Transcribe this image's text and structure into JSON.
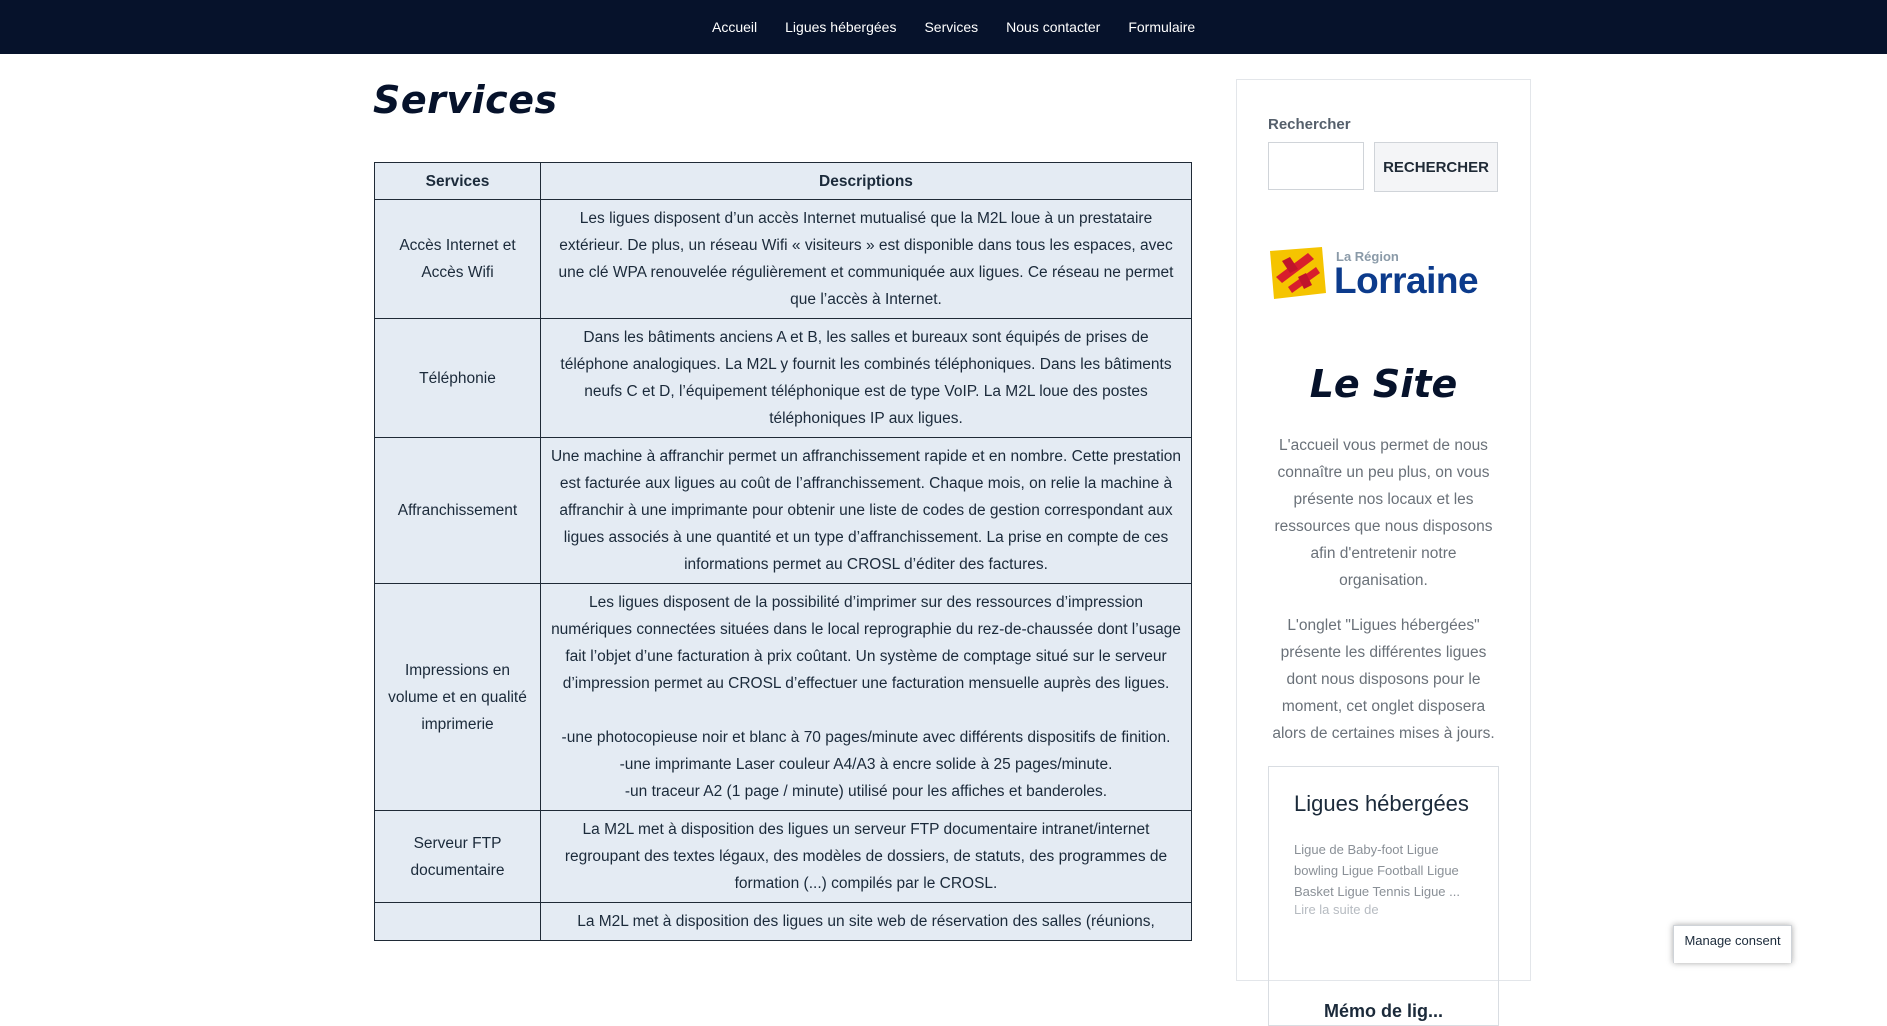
{
  "nav": {
    "items": [
      "Accueil",
      "Ligues hébergées",
      "Services",
      "Nous contacter",
      "Formulaire"
    ]
  },
  "page": {
    "title": "Services"
  },
  "table": {
    "headers": [
      "Services",
      "Descriptions"
    ],
    "rows": [
      {
        "service": "Accès Internet et Accès Wifi",
        "description": "Les ligues disposent d’un accès Internet mutualisé que la M2L loue à un prestataire extérieur. De plus, un réseau Wifi « visiteurs » est disponible dans tous les espaces, avec une clé WPA renouvelée régulièrement et communiquée aux ligues. Ce réseau ne permet que l’accès à Internet."
      },
      {
        "service": "Téléphonie",
        "description": "Dans les bâtiments anciens A et B, les salles et bureaux sont équipés de prises de téléphone analogiques. La M2L y fournit les combinés téléphoniques. Dans les bâtiments neufs C et D, l’équipement téléphonique est de type VoIP. La M2L loue des postes téléphoniques IP aux ligues."
      },
      {
        "service": "Affranchissement",
        "description": "Une machine à affranchir permet un affranchissement rapide et en nombre. Cette prestation est facturée aux ligues au coût de l’affranchissement. Chaque mois, on relie la machine à affranchir à une imprimante pour obtenir une liste de codes de gestion correspondant aux ligues associés à une quantité et un type d’affranchissement. La prise en compte de ces informations permet au CROSL d’éditer des factures."
      },
      {
        "service": "Impressions en volume et en qualité imprimerie",
        "description": "Les ligues disposent de la possibilité d’imprimer sur des ressources d’impression numériques connectées situées dans le local reprographie du rez-de-chaussée dont l’usage fait l’objet d’une facturation à prix coûtant. Un système de comptage situé sur le serveur d’impression permet au CROSL d’effectuer une facturation mensuelle auprès des ligues.",
        "extra": [
          "-une photocopieuse noir et blanc à 70 pages/minute avec différents dispositifs de finition.",
          "-une imprimante Laser couleur A4/A3 à encre solide à 25 pages/minute.",
          "-un traceur A2 (1 page / minute) utilisé pour les affiches et banderoles."
        ]
      },
      {
        "service": "Serveur FTP documentaire",
        "description": "La M2L met à disposition des ligues un serveur FTP documentaire intranet/internet regroupant des textes légaux, des modèles de dossiers, de statuts, des programmes de formation (...) compilés par le CROSL."
      },
      {
        "service": "",
        "description": "La M2L met à disposition des ligues un site web de réservation des salles (réunions,"
      }
    ]
  },
  "sidebar": {
    "search_label": "Rechercher",
    "search_placeholder": "",
    "search_button": "RECHERCHER",
    "logo": {
      "small": "La Région",
      "big": "Lorraine"
    },
    "site_heading": "Le Site",
    "site_paragraph_1": "L'accueil vous permet de nous connaître un peu plus, on vous présente nos locaux et les ressources que nous disposons afin d'entretenir notre organisation.",
    "site_paragraph_2": "L'onglet \"Ligues hébergées\" présente les différentes ligues dont nous disposons pour le moment, cet onglet disposera alors de certaines mises à jours.",
    "ligues_card": {
      "title": "Ligues hébergées",
      "excerpt": "Ligue de Baby-foot Ligue bowling Ligue Football Ligue Basket Ligue Tennis Ligue ...",
      "read_more": "Lire la suite de",
      "next_title_partial": "Mémo de lig..."
    }
  },
  "consent": {
    "label": "Manage consent"
  },
  "colors": {
    "nav_bg": "#06122b",
    "title": "#06122b",
    "table_bg": "#e4ebf3",
    "logo_blue": "#0c3b8c",
    "logo_yellow": "#f5c400",
    "logo_red": "#d81e2c"
  },
  "icons": {
    "logo_mark": "lorraine-flag-icon"
  }
}
